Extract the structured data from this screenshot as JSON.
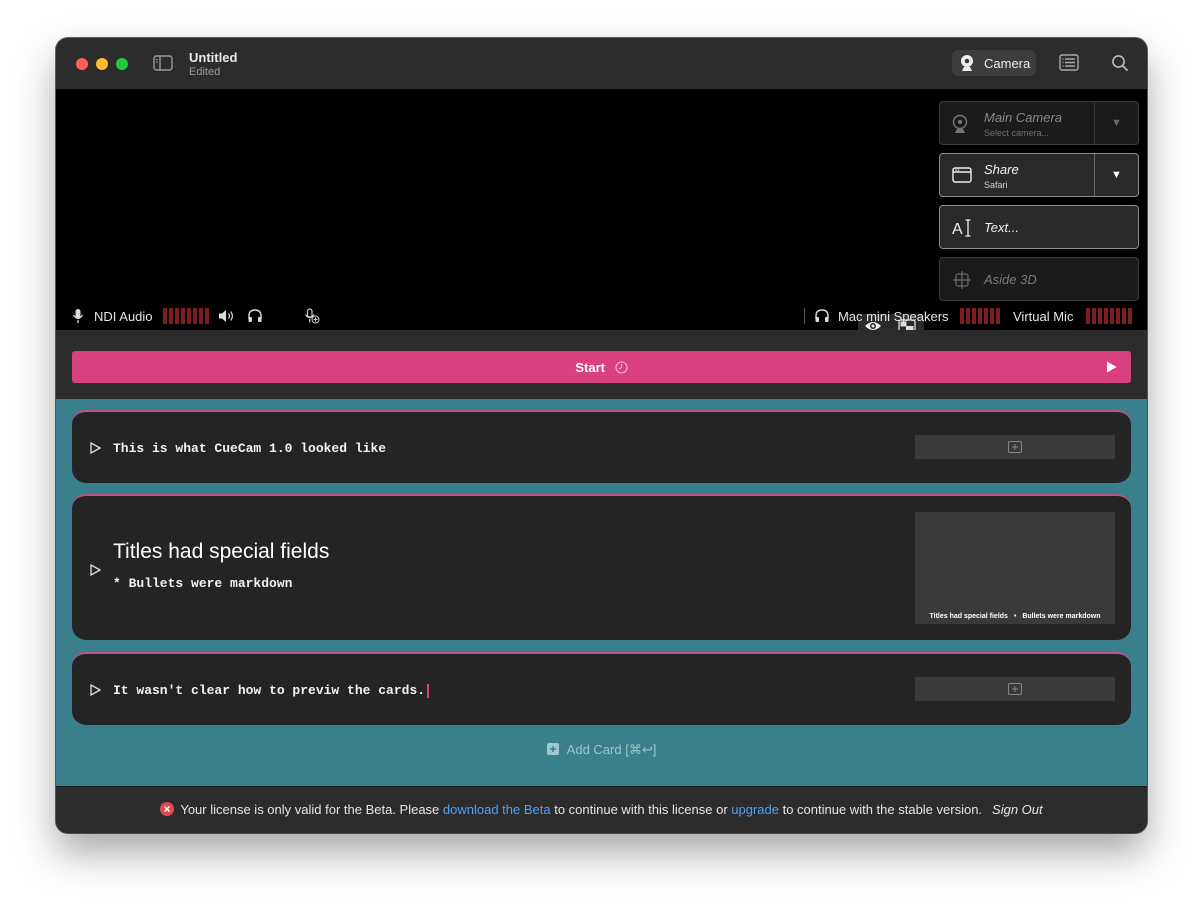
{
  "window": {
    "title": "Untitled",
    "subtitle": "Edited"
  },
  "toolbar": {
    "camera_label": "Camera",
    "icons": [
      "sidebar-toggle-icon",
      "webcam-icon",
      "notes-icon",
      "search-icon"
    ]
  },
  "sources": [
    {
      "label": "Main Camera",
      "sub": "Select camera...",
      "active": false
    },
    {
      "label": "Share",
      "sub": "Safari",
      "active": true
    },
    {
      "label": "Text...",
      "active": true
    },
    {
      "label": "Aside 3D",
      "active": false
    }
  ],
  "audio": {
    "input_label": "NDI Audio",
    "output_label": "Mac mini Speakers",
    "virtual_mic_label": "Virtual Mic"
  },
  "start": {
    "label": "Start"
  },
  "cards": [
    {
      "text": "This is what CueCam 1.0 looked like"
    },
    {
      "title": "Titles had special fields",
      "text": "* Bullets were markdown",
      "preview_caption_title": "Titles had special fields",
      "preview_caption_sep": "•",
      "preview_caption_text": "Bullets were markdown"
    },
    {
      "text": "It wasn't clear how to previw the cards."
    }
  ],
  "add_card": {
    "label": "Add Card [⌘↩]"
  },
  "license": {
    "text_1": "Your license is only valid for the Beta. Please ",
    "link_1": "download the Beta",
    "text_2": " to continue with this license or ",
    "link_2": "upgrade",
    "text_3": " to continue with the stable version.",
    "sign_out": "Sign Out"
  },
  "colors": {
    "accent": "#d9407f",
    "cards_bg": "#3a7f8c",
    "link": "#4aa1ff",
    "meter": "#7e1e1e"
  }
}
